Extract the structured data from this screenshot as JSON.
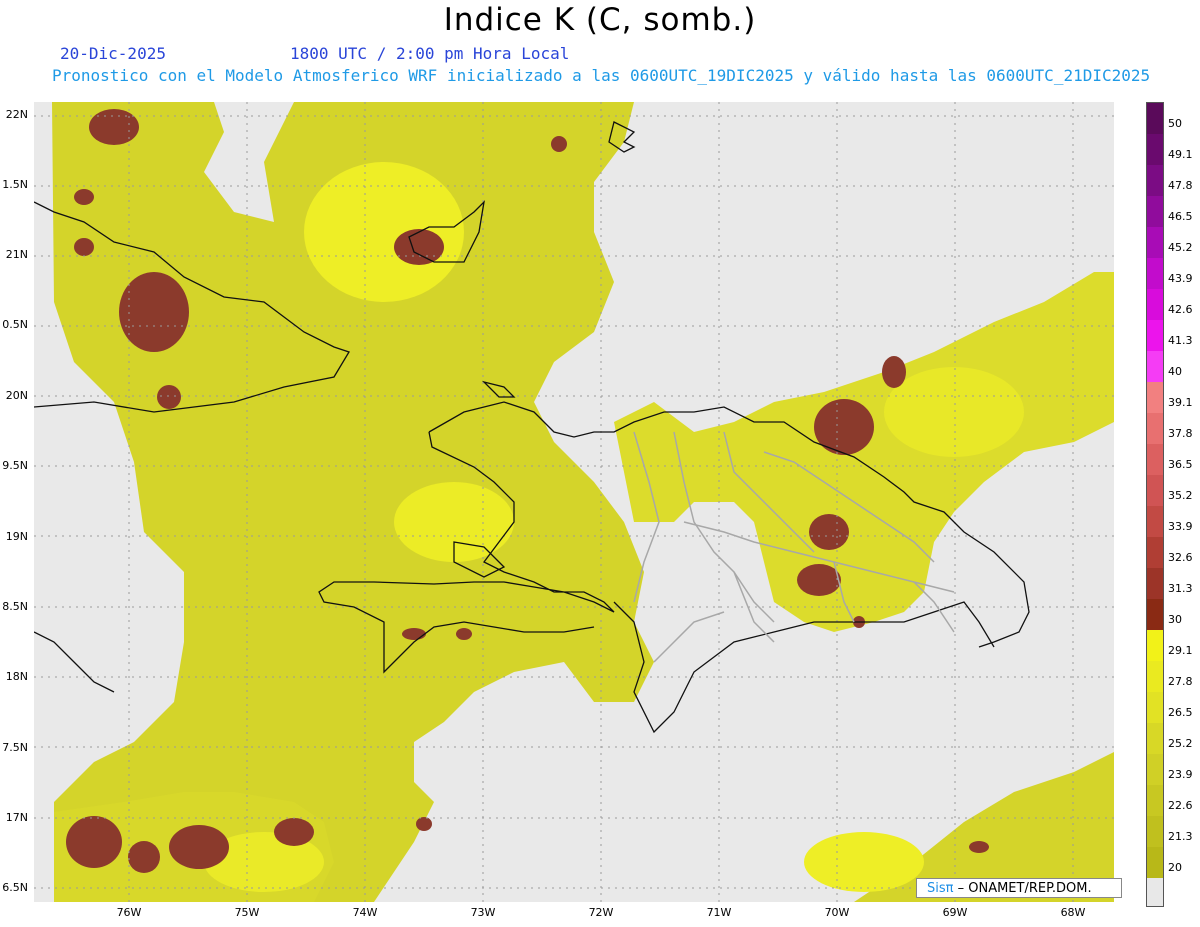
{
  "title": "Indice K (C, somb.)",
  "date": "20-Dic-2025",
  "time": "1800 UTC / 2:00 pm Hora Local",
  "model_line": "Pronostico con el Modelo Atmosferico WRF inicializado a las 0600UTC_19DIC2025 y válido hasta las  0600UTC_21DIC2025",
  "y_labels": [
    "22N",
    "1.5N",
    "21N",
    "0.5N",
    "20N",
    "9.5N",
    "19N",
    "8.5N",
    "18N",
    "7.5N",
    "17N",
    "6.5N"
  ],
  "x_labels": [
    "76W",
    "75W",
    "74W",
    "73W",
    "72W",
    "71W",
    "70W",
    "69W",
    "68W"
  ],
  "colorbar": {
    "labels": [
      "50",
      "49.1",
      "47.8",
      "46.5",
      "45.2",
      "43.9",
      "42.6",
      "41.3",
      "40",
      "39.1",
      "37.8",
      "36.5",
      "35.2",
      "33.9",
      "32.6",
      "31.3",
      "30",
      "29.1",
      "27.8",
      "26.5",
      "25.2",
      "23.9",
      "22.6",
      "21.3",
      "20"
    ],
    "colors": [
      "#5a0a5a",
      "#6a0a6e",
      "#7b0c84",
      "#900c9c",
      "#a80cb6",
      "#c20ccc",
      "#d80cdc",
      "#ec14ec",
      "#f53cf5",
      "#f28080",
      "#e87070",
      "#dc6060",
      "#d05454",
      "#c24a44",
      "#b03e34",
      "#9c3428",
      "#8a2a14",
      "#f2f218",
      "#eaea20",
      "#e2e224",
      "#d8d826",
      "#d0d026",
      "#c8c822",
      "#c0c01e",
      "#b8b818"
    ],
    "below_color": "#e8e8e8"
  },
  "field_colors": {
    "background": "#e9e9e9",
    "yellow_main": "#d6d62a",
    "yellow_light": "#f0f024",
    "yellow_dark": "#c4c41c",
    "brown": "#8b3a2c"
  },
  "credit": {
    "brand": "Sisπ",
    "text": "– ONAMET/REP.DOM."
  }
}
